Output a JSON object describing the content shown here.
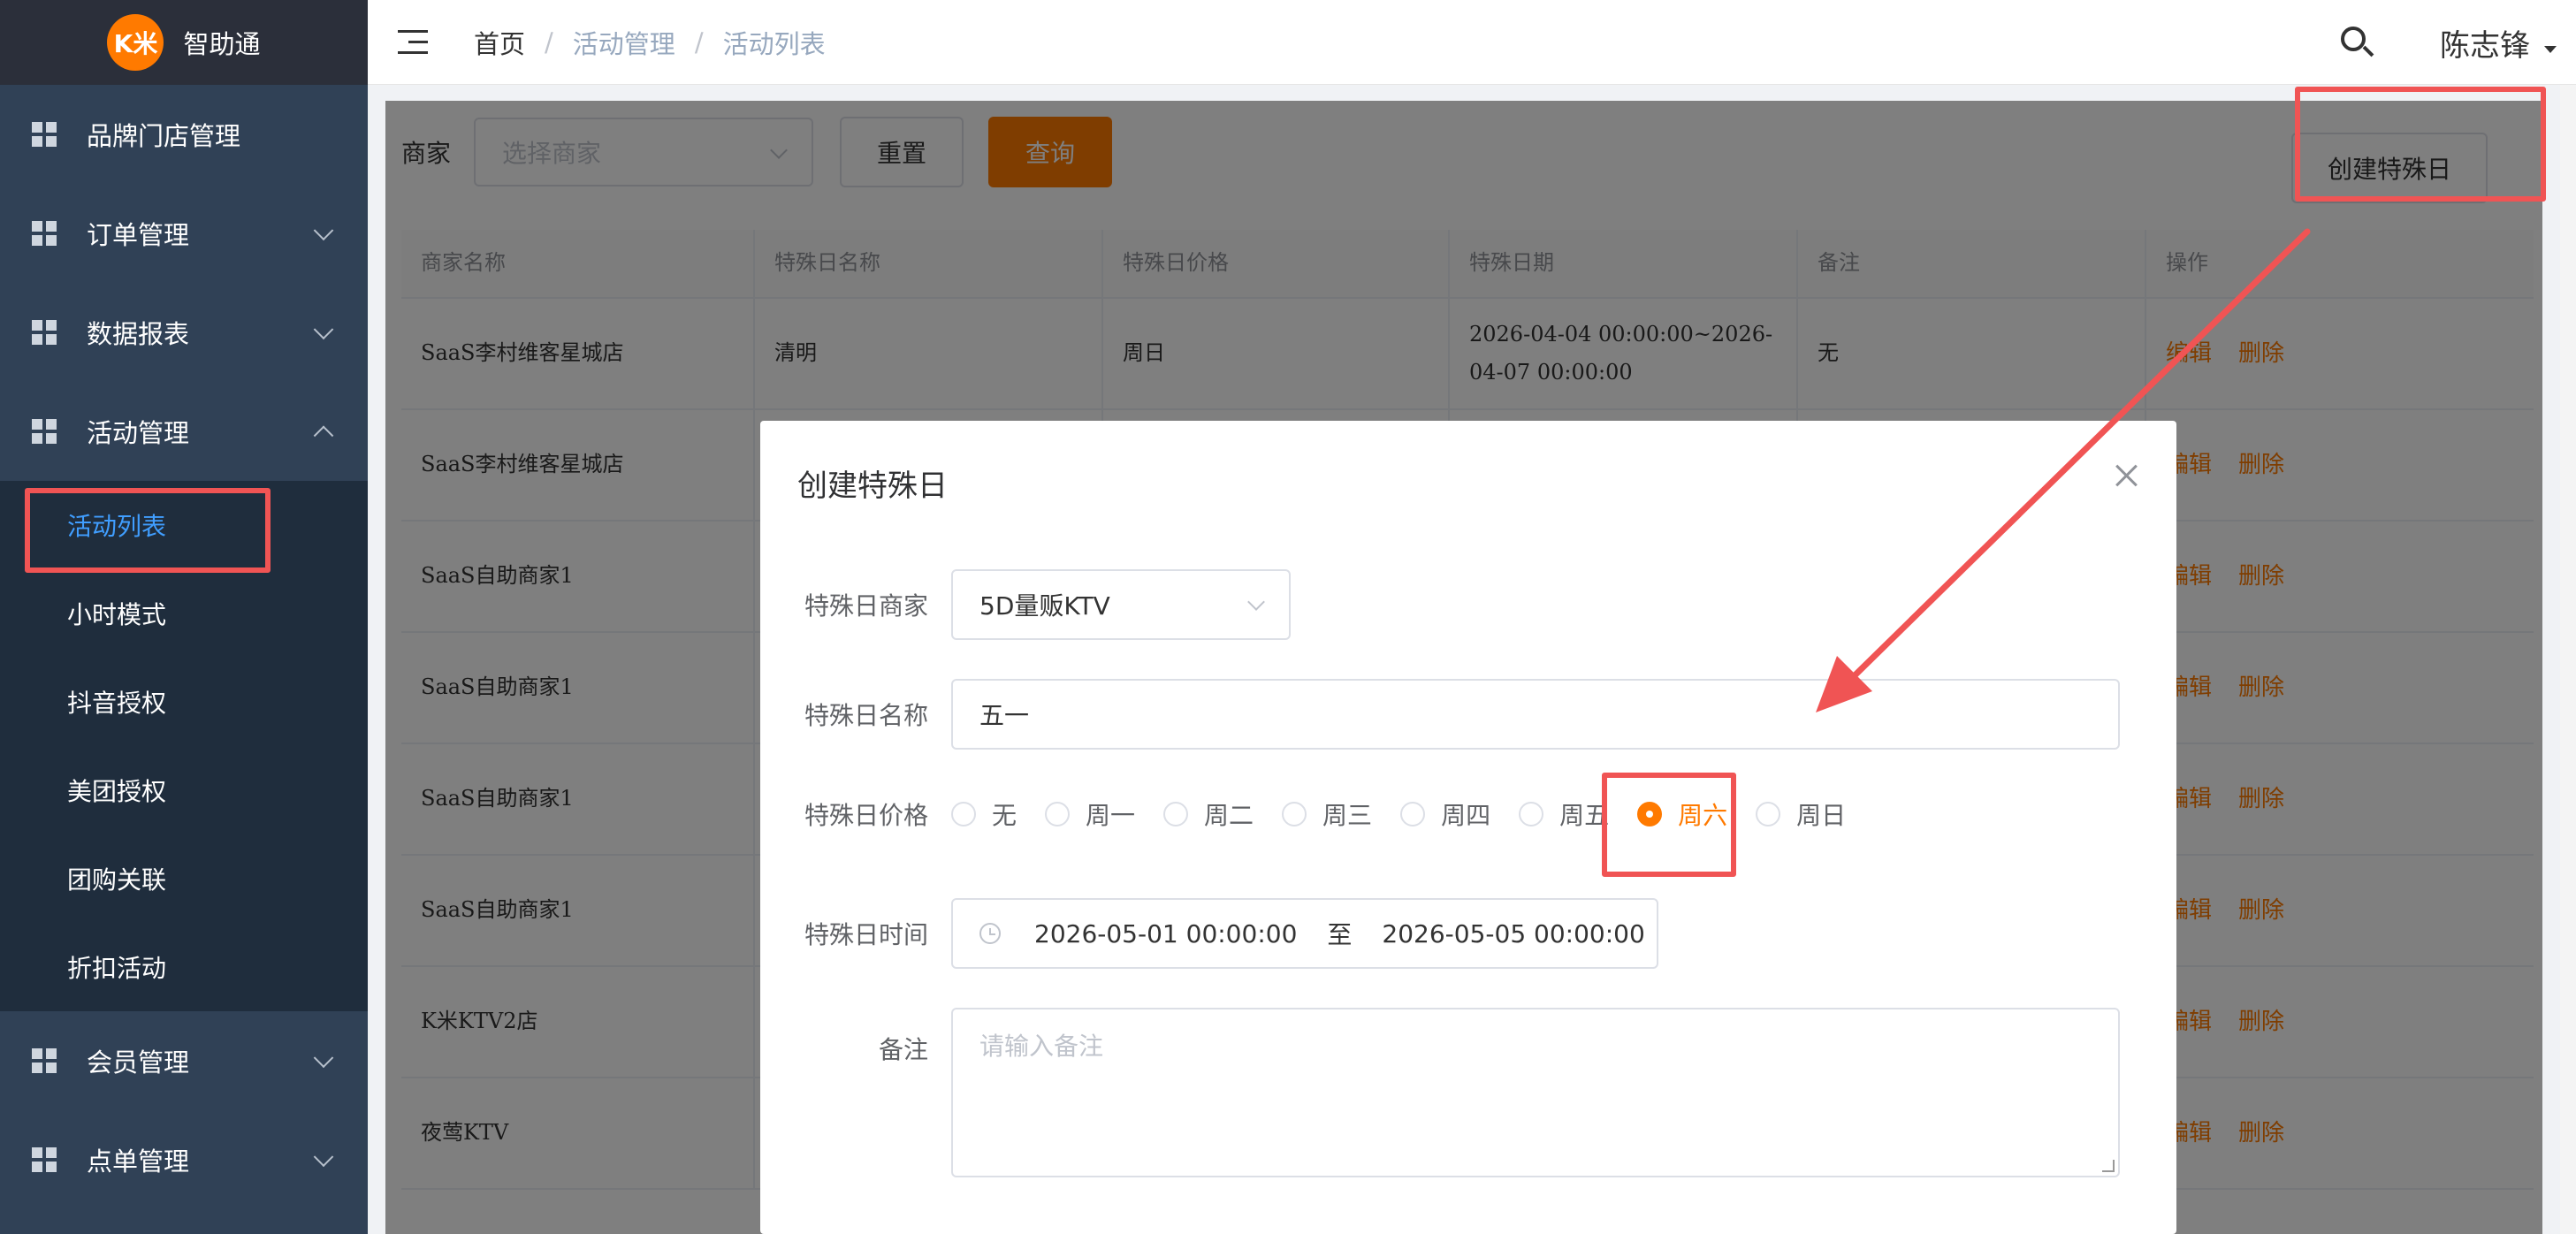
{
  "sidebar": {
    "logo_text": "K米",
    "app_name": "智助通",
    "menu": [
      {
        "label": "品牌门店管理"
      },
      {
        "label": "订单管理"
      },
      {
        "label": "数据报表"
      },
      {
        "label": "活动管理"
      }
    ],
    "submenu": [
      {
        "label": "活动列表",
        "active": true
      },
      {
        "label": "小时模式"
      },
      {
        "label": "抖音授权"
      },
      {
        "label": "美团授权"
      },
      {
        "label": "团购关联"
      },
      {
        "label": "折扣活动"
      }
    ],
    "menu_bottom": [
      {
        "label": "会员管理"
      },
      {
        "label": "点单管理"
      }
    ]
  },
  "header": {
    "breadcrumb": [
      "首页",
      "活动管理",
      "活动列表"
    ],
    "user": "陈志锋"
  },
  "filter": {
    "merchant_label": "商家",
    "merchant_placeholder": "选择商家",
    "reset": "重置",
    "query": "查询",
    "create": "创建特殊日"
  },
  "table": {
    "columns": [
      "商家名称",
      "特殊日名称",
      "特殊日价格",
      "特殊日期",
      "备注",
      "操作"
    ],
    "rows": [
      {
        "merchant": "SaaS李村维客星城店",
        "name": "清明",
        "price": "周日",
        "date": "2026-04-04 00:00:00~2026-04-07 00:00:00",
        "note": "无"
      },
      {
        "merchant": "SaaS李村维客星城店"
      },
      {
        "merchant": "SaaS自助商家1"
      },
      {
        "merchant": "SaaS自助商家1"
      },
      {
        "merchant": "SaaS自助商家1"
      },
      {
        "merchant": "SaaS自助商家1"
      },
      {
        "merchant": "K米KTV2店"
      },
      {
        "merchant": "夜莺KTV"
      }
    ],
    "op_edit": "编辑",
    "op_delete": "删除"
  },
  "modal": {
    "title": "创建特殊日",
    "merchant_label": "特殊日商家",
    "merchant_value": "5D量贩KTV",
    "name_label": "特殊日名称",
    "name_value": "五一",
    "price_label": "特殊日价格",
    "price_options": [
      "无",
      "周一",
      "周二",
      "周三",
      "周四",
      "周五",
      "周六",
      "周日"
    ],
    "price_selected": "周六",
    "time_label": "特殊日时间",
    "time_start": "2026-05-01 00:00:00",
    "time_sep": "至",
    "time_end": "2026-05-05 00:00:00",
    "note_label": "备注",
    "note_placeholder": "请输入备注"
  },
  "colors": {
    "accent": "#ff7a00",
    "sidebar_bg": "#304156",
    "highlight": "#f05454",
    "link_active": "#409eff"
  }
}
